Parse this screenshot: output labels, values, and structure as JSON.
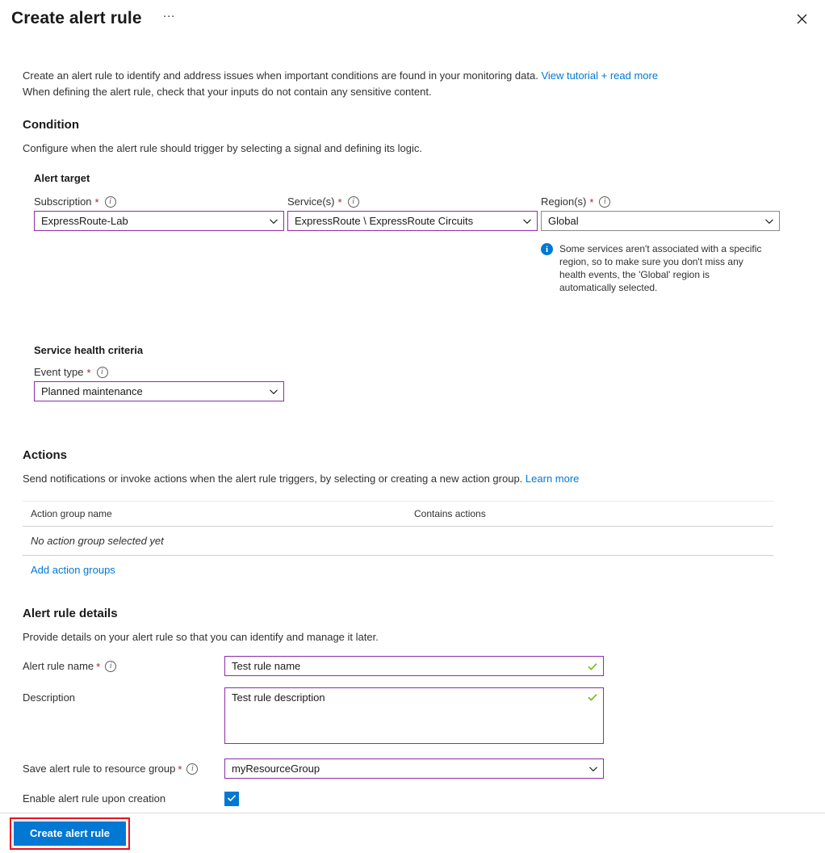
{
  "header": {
    "title": "Create alert rule",
    "more_label": "···",
    "close_icon": "close-icon"
  },
  "intro": {
    "line1": "Create an alert rule to identify and address issues when important conditions are found in your monitoring data.",
    "link": "View tutorial + read more",
    "line2": "When defining the alert rule, check that your inputs do not contain any sensitive content."
  },
  "condition": {
    "heading": "Condition",
    "description": "Configure when the alert rule should trigger by selecting a signal and defining its logic.",
    "alert_target": {
      "heading": "Alert target",
      "subscription": {
        "label": "Subscription",
        "required": "*",
        "info": "ⓘ",
        "value": "ExpressRoute-Lab"
      },
      "services": {
        "label": "Service(s)",
        "required": "*",
        "value": "ExpressRoute \\ ExpressRoute Circuits"
      },
      "regions": {
        "label": "Region(s)",
        "required": "*",
        "value": "Global"
      },
      "region_note": "Some services aren't associated with a specific region, so to make sure you don't miss any health events, the 'Global' region is automatically selected."
    },
    "service_health_criteria": {
      "heading": "Service health criteria",
      "event_type": {
        "label": "Event type",
        "required": "*",
        "value": "Planned maintenance"
      }
    }
  },
  "actions": {
    "heading": "Actions",
    "description": "Send notifications or invoke actions when the alert rule triggers, by selecting or creating a new action group.",
    "link": "Learn more",
    "table": {
      "columns": [
        "Action group name",
        "Contains actions"
      ],
      "empty_text": "No action group selected yet"
    },
    "add_link": "Add action groups"
  },
  "alert_rule_details": {
    "heading": "Alert rule details",
    "description": "Provide details on your alert rule so that you can identify and manage it later.",
    "rule_name": {
      "label": "Alert rule name",
      "required": "*",
      "value": "Test rule name"
    },
    "description_field": {
      "label": "Description",
      "value": "Test rule description"
    },
    "resource_group": {
      "label": "Save alert rule to resource group",
      "required": "*",
      "value": "myResourceGroup"
    },
    "enable_on_creation": {
      "label": "Enable alert rule upon creation",
      "checked": true
    }
  },
  "footer": {
    "create_label": "Create alert rule"
  },
  "colors": {
    "accent_blue": "#0078d4",
    "field_accent": "#8c2daa",
    "required_red": "#a4262c",
    "highlight_red": "#e81123",
    "valid_green": "#6bb700"
  }
}
